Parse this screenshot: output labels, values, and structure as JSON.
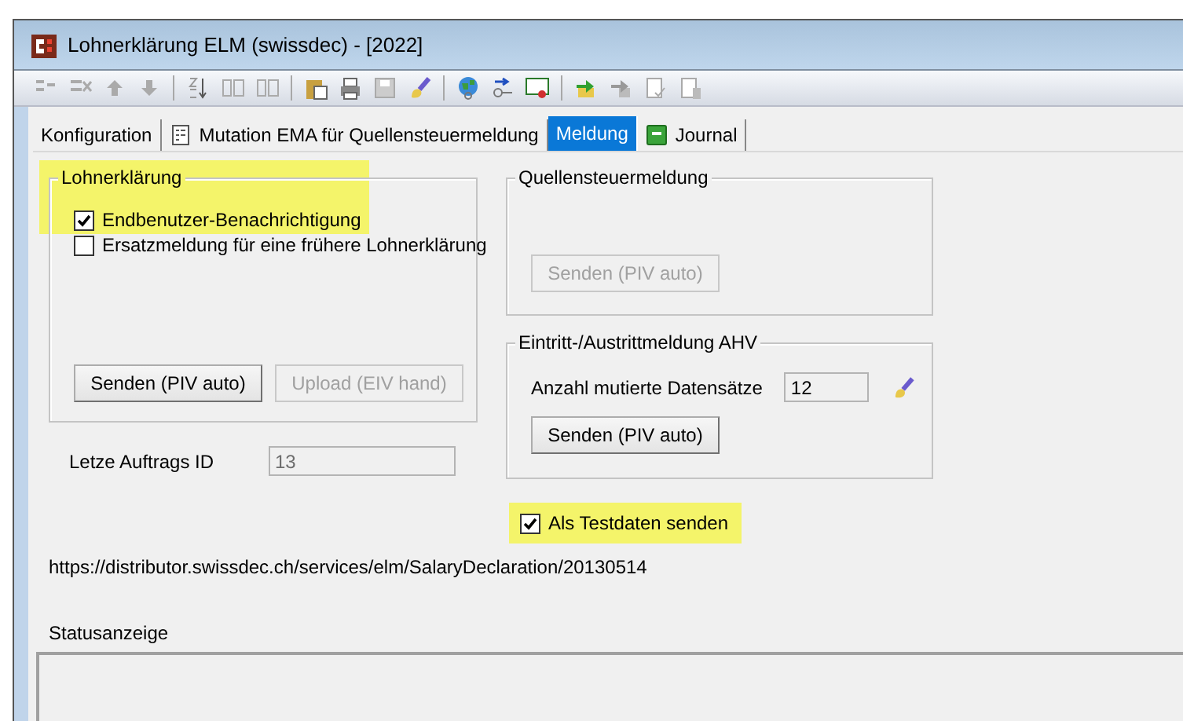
{
  "window": {
    "title": "Lohnerklärung ELM (swissdec) - [2022]"
  },
  "tabs": [
    {
      "label": "Konfiguration",
      "selected": false,
      "kind": "plain"
    },
    {
      "label": "Mutation EMA für Quellensteuermeldung",
      "selected": false,
      "kind": "document"
    },
    {
      "label": "Meldung",
      "selected": true,
      "kind": "plain"
    },
    {
      "label": "Journal",
      "selected": false,
      "kind": "journal"
    }
  ],
  "lohnerklaerung": {
    "title": "Lohnerklärung",
    "highlighted": true,
    "checkboxes": [
      {
        "label": "Endbenutzer-Benachrichtigung",
        "checked": true
      },
      {
        "label": "Ersatzmeldung für eine frühere Lohnerklärung",
        "checked": false
      }
    ],
    "buttons": [
      {
        "label": "Senden (PIV auto)",
        "disabled": false
      },
      {
        "label": "Upload (EIV hand)",
        "disabled": true
      }
    ]
  },
  "auftrags_id": {
    "label": "Letze Auftrags ID",
    "value": "13",
    "disabled": true
  },
  "quellensteuermeldung": {
    "title": "Quellensteuermeldung",
    "button": {
      "label": "Senden (PIV auto)",
      "disabled": true
    }
  },
  "eintritt_austritt": {
    "title": "Eintritt-/Austrittmeldung AHV",
    "count_label": "Anzahl mutierte Datensätze",
    "count_value": "12",
    "button": {
      "label": "Senden (PIV auto)",
      "disabled": false
    }
  },
  "testdaten": {
    "label": "Als Testdaten senden",
    "checked": true,
    "highlighted": true
  },
  "url": "https://distributor.swissdec.ch/services/elm/SalaryDeclaration/20130514",
  "status": {
    "label": "Statusanzeige"
  }
}
